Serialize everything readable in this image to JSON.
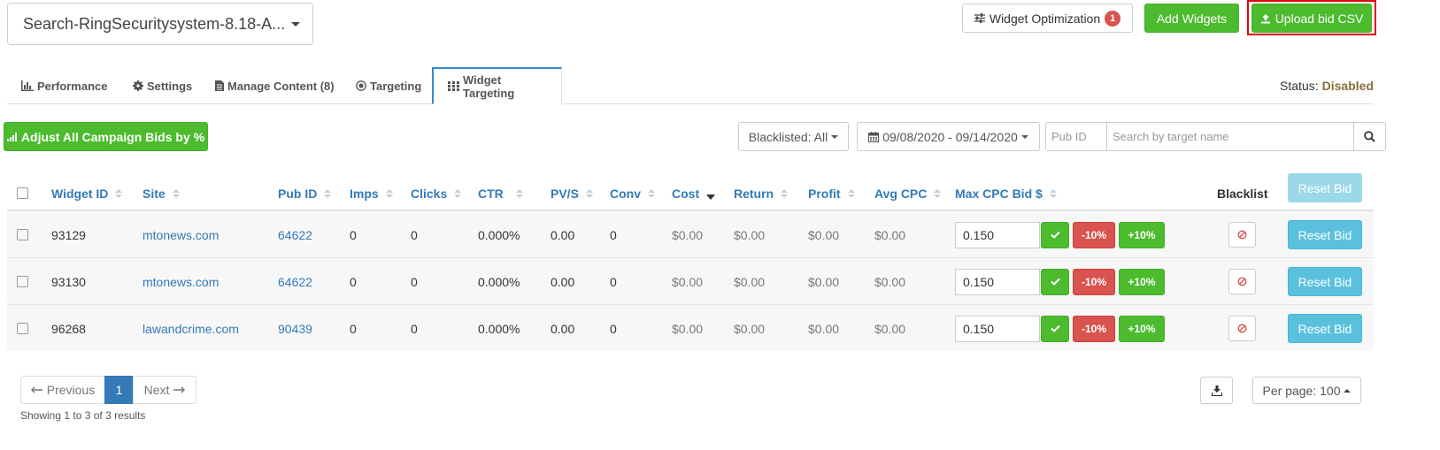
{
  "header": {
    "campaign_selected": "Search-RingSecuritysystem-8.18-A...",
    "widget_optimization_label": "Widget Optimization",
    "widget_optimization_count": "1",
    "add_widgets_label": "Add Widgets",
    "upload_bid_csv_label": "Upload bid CSV",
    "highlight_color": "#e3000f"
  },
  "tabs": [
    {
      "label": "Performance",
      "icon": "bar-chart-icon"
    },
    {
      "label": "Settings",
      "icon": "gear-icon"
    },
    {
      "label": "Manage Content (8)",
      "icon": "file-icon"
    },
    {
      "label": "Targeting",
      "icon": "target-icon"
    },
    {
      "label": "Widget Targeting",
      "icon": "grid-icon",
      "active": true
    }
  ],
  "status": {
    "label": "Status:",
    "value": "Disabled",
    "value_color": "#8a6d3b"
  },
  "toolbar": {
    "adjust_bids_label": "Adjust All Campaign Bids by %",
    "blacklisted_filter": "Blacklisted: All",
    "date_range": "09/08/2020 - 09/14/2020",
    "pub_id_placeholder": "Pub ID",
    "search_placeholder": "Search by target name"
  },
  "table": {
    "columns": [
      "Widget ID",
      "Site",
      "Pub ID",
      "Imps",
      "Clicks",
      "CTR",
      "PV/S",
      "Conv",
      "Cost",
      "Return",
      "Profit",
      "Avg CPC",
      "Max CPC Bid $",
      "Blacklist"
    ],
    "reset_bid_header": "Reset Bid",
    "decrease_label": "-10%",
    "increase_label": "+10%",
    "reset_bid_label": "Reset Bid",
    "rows": [
      {
        "widget_id": "93129",
        "site": "mtonews.com",
        "pub_id": "64622",
        "imps": "0",
        "clicks": "0",
        "ctr": "0.000%",
        "pvs": "0.00",
        "conv": "0",
        "cost": "$0.00",
        "return": "$0.00",
        "profit": "$0.00",
        "avg_cpc": "$0.00",
        "max_cpc_bid": "0.150"
      },
      {
        "widget_id": "93130",
        "site": "mtonews.com",
        "pub_id": "64622",
        "imps": "0",
        "clicks": "0",
        "ctr": "0.000%",
        "pvs": "0.00",
        "conv": "0",
        "cost": "$0.00",
        "return": "$0.00",
        "profit": "$0.00",
        "avg_cpc": "$0.00",
        "max_cpc_bid": "0.150"
      },
      {
        "widget_id": "96268",
        "site": "lawandcrime.com",
        "pub_id": "90439",
        "imps": "0",
        "clicks": "0",
        "ctr": "0.000%",
        "pvs": "0.00",
        "conv": "0",
        "cost": "$0.00",
        "return": "$0.00",
        "profit": "$0.00",
        "avg_cpc": "$0.00",
        "max_cpc_bid": "0.150"
      }
    ]
  },
  "pagination": {
    "previous_label": "Previous",
    "current_page": "1",
    "next_label": "Next",
    "summary": "Showing 1 to 3 of 3 results",
    "per_page_label": "Per page: 100"
  }
}
